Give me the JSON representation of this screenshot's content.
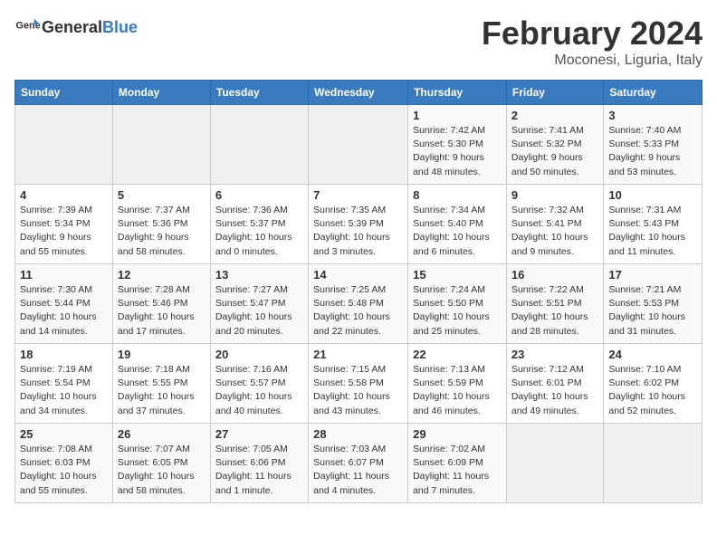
{
  "header": {
    "logo_general": "General",
    "logo_blue": "Blue",
    "month_title": "February 2024",
    "location": "Moconesi, Liguria, Italy"
  },
  "weekdays": [
    "Sunday",
    "Monday",
    "Tuesday",
    "Wednesday",
    "Thursday",
    "Friday",
    "Saturday"
  ],
  "weeks": [
    [
      {
        "day": "",
        "detail": ""
      },
      {
        "day": "",
        "detail": ""
      },
      {
        "day": "",
        "detail": ""
      },
      {
        "day": "",
        "detail": ""
      },
      {
        "day": "1",
        "detail": "Sunrise: 7:42 AM\nSunset: 5:30 PM\nDaylight: 9 hours\nand 48 minutes."
      },
      {
        "day": "2",
        "detail": "Sunrise: 7:41 AM\nSunset: 5:32 PM\nDaylight: 9 hours\nand 50 minutes."
      },
      {
        "day": "3",
        "detail": "Sunrise: 7:40 AM\nSunset: 5:33 PM\nDaylight: 9 hours\nand 53 minutes."
      }
    ],
    [
      {
        "day": "4",
        "detail": "Sunrise: 7:39 AM\nSunset: 5:34 PM\nDaylight: 9 hours\nand 55 minutes."
      },
      {
        "day": "5",
        "detail": "Sunrise: 7:37 AM\nSunset: 5:36 PM\nDaylight: 9 hours\nand 58 minutes."
      },
      {
        "day": "6",
        "detail": "Sunrise: 7:36 AM\nSunset: 5:37 PM\nDaylight: 10 hours\nand 0 minutes."
      },
      {
        "day": "7",
        "detail": "Sunrise: 7:35 AM\nSunset: 5:39 PM\nDaylight: 10 hours\nand 3 minutes."
      },
      {
        "day": "8",
        "detail": "Sunrise: 7:34 AM\nSunset: 5:40 PM\nDaylight: 10 hours\nand 6 minutes."
      },
      {
        "day": "9",
        "detail": "Sunrise: 7:32 AM\nSunset: 5:41 PM\nDaylight: 10 hours\nand 9 minutes."
      },
      {
        "day": "10",
        "detail": "Sunrise: 7:31 AM\nSunset: 5:43 PM\nDaylight: 10 hours\nand 11 minutes."
      }
    ],
    [
      {
        "day": "11",
        "detail": "Sunrise: 7:30 AM\nSunset: 5:44 PM\nDaylight: 10 hours\nand 14 minutes."
      },
      {
        "day": "12",
        "detail": "Sunrise: 7:28 AM\nSunset: 5:46 PM\nDaylight: 10 hours\nand 17 minutes."
      },
      {
        "day": "13",
        "detail": "Sunrise: 7:27 AM\nSunset: 5:47 PM\nDaylight: 10 hours\nand 20 minutes."
      },
      {
        "day": "14",
        "detail": "Sunrise: 7:25 AM\nSunset: 5:48 PM\nDaylight: 10 hours\nand 22 minutes."
      },
      {
        "day": "15",
        "detail": "Sunrise: 7:24 AM\nSunset: 5:50 PM\nDaylight: 10 hours\nand 25 minutes."
      },
      {
        "day": "16",
        "detail": "Sunrise: 7:22 AM\nSunset: 5:51 PM\nDaylight: 10 hours\nand 28 minutes."
      },
      {
        "day": "17",
        "detail": "Sunrise: 7:21 AM\nSunset: 5:53 PM\nDaylight: 10 hours\nand 31 minutes."
      }
    ],
    [
      {
        "day": "18",
        "detail": "Sunrise: 7:19 AM\nSunset: 5:54 PM\nDaylight: 10 hours\nand 34 minutes."
      },
      {
        "day": "19",
        "detail": "Sunrise: 7:18 AM\nSunset: 5:55 PM\nDaylight: 10 hours\nand 37 minutes."
      },
      {
        "day": "20",
        "detail": "Sunrise: 7:16 AM\nSunset: 5:57 PM\nDaylight: 10 hours\nand 40 minutes."
      },
      {
        "day": "21",
        "detail": "Sunrise: 7:15 AM\nSunset: 5:58 PM\nDaylight: 10 hours\nand 43 minutes."
      },
      {
        "day": "22",
        "detail": "Sunrise: 7:13 AM\nSunset: 5:59 PM\nDaylight: 10 hours\nand 46 minutes."
      },
      {
        "day": "23",
        "detail": "Sunrise: 7:12 AM\nSunset: 6:01 PM\nDaylight: 10 hours\nand 49 minutes."
      },
      {
        "day": "24",
        "detail": "Sunrise: 7:10 AM\nSunset: 6:02 PM\nDaylight: 10 hours\nand 52 minutes."
      }
    ],
    [
      {
        "day": "25",
        "detail": "Sunrise: 7:08 AM\nSunset: 6:03 PM\nDaylight: 10 hours\nand 55 minutes."
      },
      {
        "day": "26",
        "detail": "Sunrise: 7:07 AM\nSunset: 6:05 PM\nDaylight: 10 hours\nand 58 minutes."
      },
      {
        "day": "27",
        "detail": "Sunrise: 7:05 AM\nSunset: 6:06 PM\nDaylight: 11 hours\nand 1 minute."
      },
      {
        "day": "28",
        "detail": "Sunrise: 7:03 AM\nSunset: 6:07 PM\nDaylight: 11 hours\nand 4 minutes."
      },
      {
        "day": "29",
        "detail": "Sunrise: 7:02 AM\nSunset: 6:09 PM\nDaylight: 11 hours\nand 7 minutes."
      },
      {
        "day": "",
        "detail": ""
      },
      {
        "day": "",
        "detail": ""
      }
    ]
  ]
}
